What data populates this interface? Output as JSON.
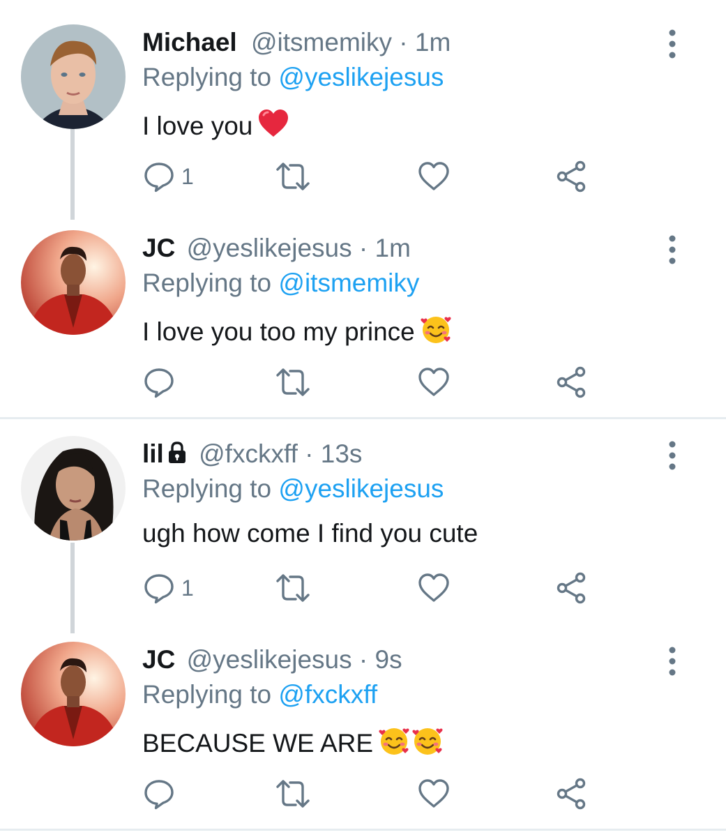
{
  "tweets": [
    {
      "name": "Michael",
      "handle": "@itsmemiky",
      "time": "1m",
      "replying_label": "Replying to",
      "replying_to": "@yeslikejesus",
      "text": "I love you",
      "emoji": "heart",
      "reply_count": "1",
      "avatar": "michael",
      "locked": false
    },
    {
      "name": "JC",
      "handle": "@yeslikejesus",
      "time": "1m",
      "replying_label": "Replying to",
      "replying_to": "@itsmemiky",
      "text": "I love you too my prince",
      "emoji": "smiling-face-with-hearts",
      "reply_count": "",
      "avatar": "jc",
      "locked": false
    },
    {
      "name": "lil",
      "handle": "@fxckxff",
      "time": "13s",
      "replying_label": "Replying to",
      "replying_to": "@yeslikejesus",
      "text": "ugh how come I find you cute",
      "emoji": "",
      "reply_count": "1",
      "avatar": "lil",
      "locked": true
    },
    {
      "name": "JC",
      "handle": "@yeslikejesus",
      "time": "9s",
      "replying_label": "Replying to",
      "replying_to": "@fxckxff",
      "text": "BECAUSE WE ARE",
      "emoji": "smiling-face-with-hearts x2",
      "reply_count": "",
      "avatar": "jc",
      "locked": false
    }
  ],
  "separator": "·",
  "icons": {
    "reply": "reply-bubble-icon",
    "retweet": "retweet-icon",
    "like": "heart-outline-icon",
    "share": "share-icon",
    "more": "vertical-dots-icon",
    "lock": "lock-icon"
  },
  "colors": {
    "link": "#1da1f2",
    "muted": "#657786",
    "text": "#14171a",
    "thread_line": "#d0d5d9",
    "divider": "#e6ecf0"
  }
}
